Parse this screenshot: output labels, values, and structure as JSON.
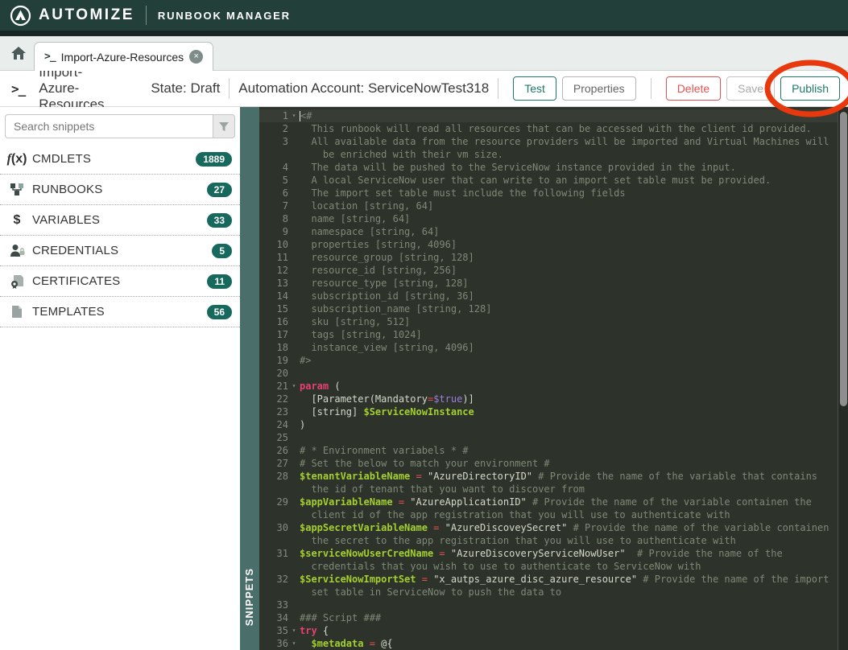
{
  "header": {
    "brand": "AUTOMIZE",
    "product": "RUNBOOK MANAGER"
  },
  "tab": {
    "label": "Import-Azure-Resources",
    "close": "×"
  },
  "toolbar": {
    "title": "Import-Azure-Resources",
    "state_label": "State: Draft",
    "account_label": "Automation Account: ServiceNowTest318",
    "buttons": {
      "test": "Test",
      "properties": "Properties",
      "delete": "Delete",
      "save": "Save",
      "publish": "Publish"
    }
  },
  "sidebar": {
    "search_placeholder": "Search snippets",
    "panel_label": "SNIPPETS",
    "items": [
      {
        "id": "cmdlets",
        "label": "CMDLETS",
        "count": "1889",
        "icon": "function-icon"
      },
      {
        "id": "runbooks",
        "label": "RUNBOOKS",
        "count": "27",
        "icon": "runbook-icon"
      },
      {
        "id": "variables",
        "label": "VARIABLES",
        "count": "33",
        "icon": "variable-icon"
      },
      {
        "id": "credentials",
        "label": "CREDENTIALS",
        "count": "5",
        "icon": "credential-icon"
      },
      {
        "id": "certificates",
        "label": "CERTIFICATES",
        "count": "11",
        "icon": "certificate-icon"
      },
      {
        "id": "templates",
        "label": "TEMPLATES",
        "count": "56",
        "icon": "template-icon"
      }
    ]
  },
  "colors": {
    "--header-bg": "#223f3a",
    "--accent": "#1d7a68",
    "--danger": "#e05252",
    "--badge": "#17695e",
    "--annotation": "#e8380d",
    "--ed-bg": "#2d322b",
    "--tk-ln": "#878a80",
    "--tk-c": "#7e8976",
    "--tk-p": "#d6dacc",
    "--tk-k": "#e93f72",
    "--tk-o": "#e35252",
    "--tk-v": "#a4cf2e",
    "--tk-t": "#9c7fdb"
  },
  "editor": {
    "rows": [
      {
        "n": "1",
        "fold": true,
        "cursor": true,
        "active": true,
        "seg": [
          [
            "c",
            "<#"
          ]
        ]
      },
      {
        "n": "2",
        "seg": [
          [
            "c",
            "  This runbook will read all resources that can be accessed with the client id provided."
          ]
        ]
      },
      {
        "n": "3",
        "seg": [
          [
            "c",
            "  All available data from the resource providers will be imported and Virtual Machines will"
          ]
        ]
      },
      {
        "n": "",
        "seg": [
          [
            "c",
            "    be enriched with their vm size."
          ]
        ]
      },
      {
        "n": "4",
        "seg": [
          [
            "c",
            "  The data will be pushed to the ServiceNow instance provided in the input."
          ]
        ]
      },
      {
        "n": "5",
        "seg": [
          [
            "c",
            "  A local ServiceNow user that can write to an import set table must be provided."
          ]
        ]
      },
      {
        "n": "6",
        "seg": [
          [
            "c",
            "  The import set table must include the following fields"
          ]
        ]
      },
      {
        "n": "7",
        "seg": [
          [
            "c",
            "  location [string, 64]"
          ]
        ]
      },
      {
        "n": "8",
        "seg": [
          [
            "c",
            "  name [string, 64]"
          ]
        ]
      },
      {
        "n": "9",
        "seg": [
          [
            "c",
            "  namespace [string, 64]"
          ]
        ]
      },
      {
        "n": "10",
        "seg": [
          [
            "c",
            "  properties [string, 4096]"
          ]
        ]
      },
      {
        "n": "11",
        "seg": [
          [
            "c",
            "  resource_group [string, 128]"
          ]
        ]
      },
      {
        "n": "12",
        "seg": [
          [
            "c",
            "  resource_id [string, 256]"
          ]
        ]
      },
      {
        "n": "13",
        "seg": [
          [
            "c",
            "  resource_type [string, 128]"
          ]
        ]
      },
      {
        "n": "14",
        "seg": [
          [
            "c",
            "  subscription_id [string, 36]"
          ]
        ]
      },
      {
        "n": "15",
        "seg": [
          [
            "c",
            "  subscription_name [string, 128]"
          ]
        ]
      },
      {
        "n": "16",
        "seg": [
          [
            "c",
            "  sku [string, 512]"
          ]
        ]
      },
      {
        "n": "17",
        "seg": [
          [
            "c",
            "  tags [string, 1024]"
          ]
        ]
      },
      {
        "n": "18",
        "seg": [
          [
            "c",
            "  instance_view [string, 4096]"
          ]
        ]
      },
      {
        "n": "19",
        "seg": [
          [
            "c",
            "#>"
          ]
        ]
      },
      {
        "n": "20",
        "seg": []
      },
      {
        "n": "21",
        "fold": true,
        "seg": [
          [
            "k",
            "param"
          ],
          [
            "p",
            " ("
          ]
        ]
      },
      {
        "n": "22",
        "seg": [
          [
            "p",
            "  [Parameter(Mandatory"
          ],
          [
            "o",
            "="
          ],
          [
            "t",
            "$true"
          ],
          [
            "p",
            ")]"
          ]
        ]
      },
      {
        "n": "23",
        "seg": [
          [
            "p",
            "  [string] "
          ],
          [
            "v",
            "$ServiceNowInstance"
          ]
        ]
      },
      {
        "n": "24",
        "seg": [
          [
            "p",
            ")"
          ]
        ]
      },
      {
        "n": "25",
        "seg": []
      },
      {
        "n": "26",
        "seg": [
          [
            "c",
            "# * Environment variabels * #"
          ]
        ]
      },
      {
        "n": "27",
        "seg": [
          [
            "c",
            "# Set the below to match your environment #"
          ]
        ]
      },
      {
        "n": "28",
        "seg": [
          [
            "v",
            "$tenantVariableName"
          ],
          [
            "o",
            " = "
          ],
          [
            "p",
            "\"AzureDirectoryID\""
          ],
          [
            "c",
            " # Provide the name of the variable that contains"
          ]
        ]
      },
      {
        "n": "",
        "seg": [
          [
            "c",
            "  the id of tenant that you want to discover from"
          ]
        ]
      },
      {
        "n": "29",
        "seg": [
          [
            "v",
            "$appVariableName"
          ],
          [
            "o",
            " = "
          ],
          [
            "p",
            "\"AzureApplicationID\""
          ],
          [
            "c",
            " # Provide the name of the variable containen the"
          ]
        ]
      },
      {
        "n": "",
        "seg": [
          [
            "c",
            "  client id of the app registration that you will use to authenticate with"
          ]
        ]
      },
      {
        "n": "30",
        "seg": [
          [
            "v",
            "$appSecretVariableName"
          ],
          [
            "o",
            " = "
          ],
          [
            "p",
            "\"AzureDiscoveySecret\""
          ],
          [
            "c",
            " # Provide the name of the variable containen"
          ]
        ]
      },
      {
        "n": "",
        "seg": [
          [
            "c",
            "  the secret to the app registration that you will use to authenticate with"
          ]
        ]
      },
      {
        "n": "31",
        "seg": [
          [
            "v",
            "$serviceNowUserCredName"
          ],
          [
            "o",
            " = "
          ],
          [
            "p",
            "\"AzureDiscoveryServiceNowUser\""
          ],
          [
            "c",
            "  # Provide the name of the"
          ]
        ]
      },
      {
        "n": "",
        "seg": [
          [
            "c",
            "  credentials that you wish to use to authenticate to ServiceNow with"
          ]
        ]
      },
      {
        "n": "32",
        "seg": [
          [
            "v",
            "$ServiceNowImportSet"
          ],
          [
            "o",
            " = "
          ],
          [
            "p",
            "\"x_autps_azure_disc_azure_resource\""
          ],
          [
            "c",
            " # Provide the name of the import"
          ]
        ]
      },
      {
        "n": "",
        "seg": [
          [
            "c",
            "  set table in ServiceNow to push the data to"
          ]
        ]
      },
      {
        "n": "33",
        "seg": []
      },
      {
        "n": "34",
        "seg": [
          [
            "c",
            "### Script ###"
          ]
        ]
      },
      {
        "n": "35",
        "fold": true,
        "seg": [
          [
            "k",
            "try"
          ],
          [
            "p",
            " {"
          ]
        ]
      },
      {
        "n": "36",
        "fold": true,
        "seg": [
          [
            "p",
            "  "
          ],
          [
            "v",
            "$metadata"
          ],
          [
            "o",
            " = "
          ],
          [
            "p",
            "@{"
          ]
        ]
      }
    ]
  }
}
